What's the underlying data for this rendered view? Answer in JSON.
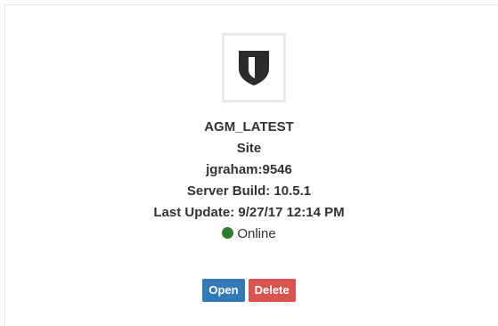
{
  "site": {
    "logo_icon": "shield-icon",
    "name": "AGM_LATEST",
    "type": "Site",
    "host": "jgraham:9546",
    "server_build": "Server Build: 10.5.1",
    "last_update": "Last Update: 9/27/17 12:14 PM",
    "status": {
      "label": "Online",
      "color": "#2e7d32"
    }
  },
  "actions": {
    "open_label": "Open",
    "delete_label": "Delete",
    "open_color": "#337ab7",
    "delete_color": "#d9534f"
  }
}
